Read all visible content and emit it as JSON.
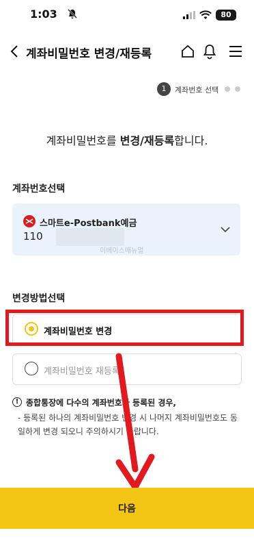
{
  "status_bar": {
    "time": "1:03",
    "battery": "80"
  },
  "header": {
    "title": "계좌비밀번호 변경/재등록"
  },
  "step": {
    "number": "1",
    "label": "계좌번호 선택"
  },
  "headline": {
    "prefix": "계좌비밀번호를 ",
    "bold": "변경/재등록",
    "suffix": "합니다."
  },
  "account_section": {
    "label": "계좌번호선택",
    "account_name": "스마트e-Postbank예금",
    "account_number": "110",
    "watermark": "이베이스매뉴얼"
  },
  "method_section": {
    "label": "변경방법선택",
    "options": [
      {
        "label": "계좌비밀번호 변경",
        "selected": true
      },
      {
        "label": "계좌비밀번호 재등록",
        "selected": false
      }
    ]
  },
  "notice": {
    "icon": "!",
    "title": "종합통장에 다수의 계좌번호가 등록된 경우,",
    "body": "- 등록된 하나의 계좌비밀번호 변경 시 나머지 계좌비밀번호도 동일하게 변경 되오니 주의하시기 바랍니다."
  },
  "next_button": {
    "label": "다음"
  },
  "colors": {
    "accent": "#f5c515",
    "highlight": "#e2191f",
    "card": "#eaf3fb"
  }
}
